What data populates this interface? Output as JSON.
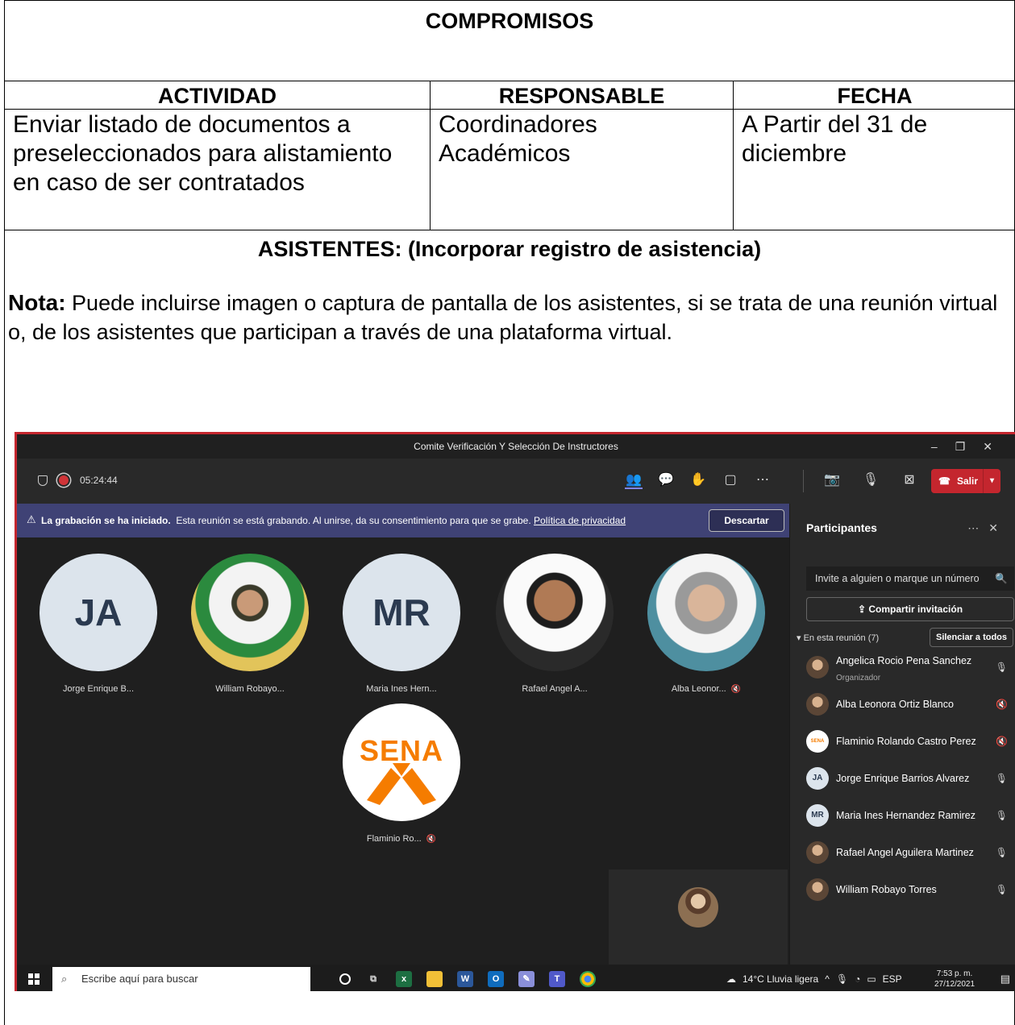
{
  "doc": {
    "compromisos_title": "COMPROMISOS",
    "headers": {
      "actividad": "ACTIVIDAD",
      "responsable": "RESPONSABLE",
      "fecha": "FECHA"
    },
    "row": {
      "actividad": "Enviar listado de documentos a preseleccionados para alistamiento en caso de ser contratados",
      "responsable": "Coordinadores Académicos",
      "fecha": "A Partir del 31 de diciembre"
    },
    "asistentes_title": "ASISTENTES: (Incorporar registro de asistencia)",
    "note_label": "Nota:",
    "note_text": " Puede incluirse imagen o captura de pantalla de los asistentes, si se trata de una reunión virtual o, de los asistentes que participan a través de una plataforma virtual."
  },
  "teams": {
    "window_title": "Comite Verificación Y Selección De Instructores",
    "timer": "05:24:44",
    "leave_label": "Salir",
    "banner": {
      "bold": "La grabación se ha iniciado.",
      "text": "Esta reunión se está grabando. Al unirse, da su consentimiento para que se grabe.",
      "link": "Política de privacidad",
      "dismiss": "Descartar"
    },
    "tiles": [
      {
        "initials": "JA",
        "name": "Jorge Enrique B..."
      },
      {
        "initials": "",
        "name": "William Robayo..."
      },
      {
        "initials": "MR",
        "name": "Maria Ines Hern..."
      },
      {
        "initials": "",
        "name": "Rafael Angel A..."
      },
      {
        "initials": "",
        "name": "Alba Leonor..."
      },
      {
        "initials": "SENA",
        "name": "Flaminio Ro..."
      }
    ],
    "panel": {
      "title": "Participantes",
      "invite_placeholder": "Invite a alguien o marque un número",
      "share": "Compartir invitación",
      "in_meeting": "En esta reunión (7)",
      "mute_all": "Silenciar a todos",
      "participants": [
        {
          "name": "Angelica Rocio Pena Sanchez",
          "role": "Organizador",
          "initials": ""
        },
        {
          "name": "Alba Leonora Ortiz Blanco",
          "role": "",
          "initials": ""
        },
        {
          "name": "Flaminio Rolando Castro Perez",
          "role": "",
          "initials": "SENA"
        },
        {
          "name": "Jorge Enrique Barrios Alvarez",
          "role": "",
          "initials": "JA"
        },
        {
          "name": "Maria Ines Hernandez Ramirez",
          "role": "",
          "initials": "MR"
        },
        {
          "name": "Rafael Angel Aguilera Martinez",
          "role": "",
          "initials": ""
        },
        {
          "name": "William Robayo Torres",
          "role": "",
          "initials": ""
        }
      ]
    },
    "taskbar": {
      "search_placeholder": "Escribe aquí para buscar",
      "weather": "14°C  Lluvia ligera",
      "lang": "ESP",
      "time": "7:53 p. m.",
      "date": "27/12/2021"
    }
  }
}
